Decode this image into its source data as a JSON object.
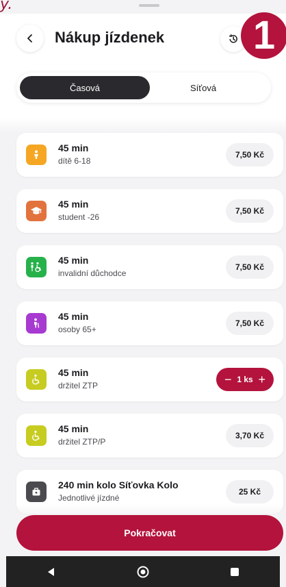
{
  "corner_fragment": "y.",
  "header": {
    "title": "Nákup jízdenek",
    "back_icon": "chevron-left-icon",
    "history_icon": "history-icon",
    "step_badge": "1"
  },
  "tabs": [
    {
      "label": "Časová",
      "active": true
    },
    {
      "label": "Síťová",
      "active": false
    }
  ],
  "tickets": [
    {
      "title": "45 min",
      "subtitle": "dítě 6-18",
      "price": "7,50 Kč",
      "icon": "child-icon",
      "color": "#f5a623"
    },
    {
      "title": "45 min",
      "subtitle": "student -26",
      "price": "7,50 Kč",
      "icon": "graduation-cap-icon",
      "color": "#e2733d"
    },
    {
      "title": "45 min",
      "subtitle": "invalidní důchodce",
      "price": "7,50 Kč",
      "icon": "disabled-pensioner-icon",
      "color": "#27b14a"
    },
    {
      "title": "45 min",
      "subtitle": "osoby 65+",
      "price": "7,50 Kč",
      "icon": "senior-icon",
      "color": "#a73ad0"
    },
    {
      "title": "45 min",
      "subtitle": "držitel ZTP",
      "price": "",
      "icon": "wheelchair-icon",
      "color": "#c7cc21",
      "quantity": {
        "minus": "−",
        "label": "1 ks",
        "plus": "+"
      }
    },
    {
      "title": "45 min",
      "subtitle": "držitel ZTP/P",
      "price": "3,70 Kč",
      "icon": "wheelchair-icon",
      "color": "#c7cc21"
    },
    {
      "title": "240 min kolo Síťovka Kolo",
      "subtitle": "Jednotlivé jízdné",
      "price": "25 Kč",
      "icon": "luggage-icon",
      "color": "#4b4b4f"
    }
  ],
  "continue_label": "Pokračovat",
  "navbar": {
    "back_icon": "back-triangle-icon",
    "home_icon": "home-circle-icon",
    "recents_icon": "recents-square-icon"
  }
}
